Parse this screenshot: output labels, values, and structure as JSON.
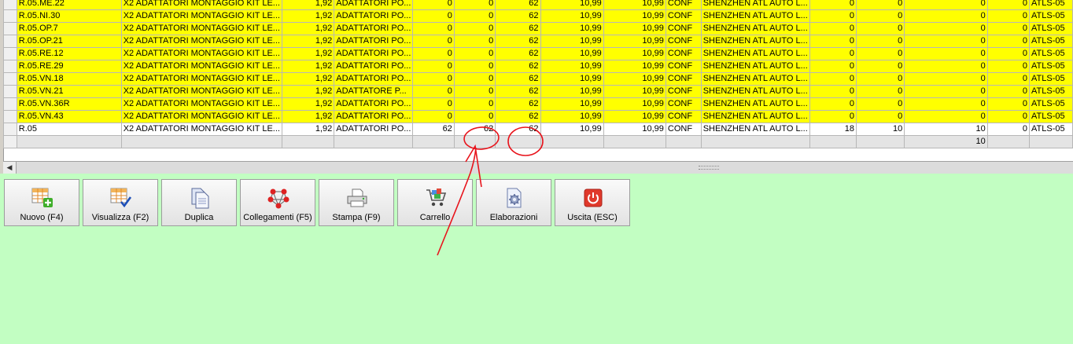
{
  "grid": {
    "rows": [
      {
        "style": "yellow",
        "cells": [
          "R.05.ME.22",
          "X2 ADATTATORI MONTAGGIO KIT LE...",
          "1,92",
          "ADATTATORI PO...",
          "0",
          "0",
          "62",
          "10,99",
          "10,99",
          "CONF",
          "SHENZHEN ATL AUTO L...",
          "0",
          "0",
          "0",
          "0",
          "ATLS-05"
        ]
      },
      {
        "style": "yellow",
        "cells": [
          "R.05.NI.30",
          "X2 ADATTATORI MONTAGGIO KIT LE...",
          "1,92",
          "ADATTATORI PO...",
          "0",
          "0",
          "62",
          "10,99",
          "10,99",
          "CONF",
          "SHENZHEN ATL AUTO L...",
          "0",
          "0",
          "0",
          "0",
          "ATLS-05"
        ]
      },
      {
        "style": "yellow",
        "cells": [
          "R.05.OP.7",
          "X2 ADATTATORI MONTAGGIO KIT LE...",
          "1,92",
          "ADATTATORI PO...",
          "0",
          "0",
          "62",
          "10,99",
          "10,99",
          "CONF",
          "SHENZHEN ATL AUTO L...",
          "0",
          "0",
          "0",
          "0",
          "ATLS-05"
        ]
      },
      {
        "style": "yellow",
        "cells": [
          "R.05.OP.21",
          "X2 ADATTATORI MONTAGGIO KIT LE...",
          "1,92",
          "ADATTATORI PO...",
          "0",
          "0",
          "62",
          "10,99",
          "10,99",
          "CONF",
          "SHENZHEN ATL AUTO L...",
          "0",
          "0",
          "0",
          "0",
          "ATLS-05"
        ]
      },
      {
        "style": "yellow",
        "cells": [
          "R.05.RE.12",
          "X2 ADATTATORI MONTAGGIO KIT LE...",
          "1,92",
          "ADATTATORI PO...",
          "0",
          "0",
          "62",
          "10,99",
          "10,99",
          "CONF",
          "SHENZHEN ATL AUTO L...",
          "0",
          "0",
          "0",
          "0",
          "ATLS-05"
        ]
      },
      {
        "style": "yellow",
        "cells": [
          "R.05.RE.29",
          "X2 ADATTATORI MONTAGGIO KIT LE...",
          "1,92",
          "ADATTATORI PO...",
          "0",
          "0",
          "62",
          "10,99",
          "10,99",
          "CONF",
          "SHENZHEN ATL AUTO L...",
          "0",
          "0",
          "0",
          "0",
          "ATLS-05"
        ]
      },
      {
        "style": "yellow",
        "cells": [
          "R.05.VN.18",
          "X2 ADATTATORI MONTAGGIO KIT LE...",
          "1,92",
          "ADATTATORI PO...",
          "0",
          "0",
          "62",
          "10,99",
          "10,99",
          "CONF",
          "SHENZHEN ATL AUTO L...",
          "0",
          "0",
          "0",
          "0",
          "ATLS-05"
        ]
      },
      {
        "style": "yellow",
        "cells": [
          "R.05.VN.21",
          "X2 ADATTATORI MONTAGGIO KIT LE...",
          "1,92",
          "ADATTATORE P...",
          "0",
          "0",
          "62",
          "10,99",
          "10,99",
          "CONF",
          "SHENZHEN ATL AUTO L...",
          "0",
          "0",
          "0",
          "0",
          "ATLS-05"
        ]
      },
      {
        "style": "yellow",
        "cells": [
          "R.05.VN.36R",
          "X2 ADATTATORI MONTAGGIO KIT LE...",
          "1,92",
          "ADATTATORI PO...",
          "0",
          "0",
          "62",
          "10,99",
          "10,99",
          "CONF",
          "SHENZHEN ATL AUTO L...",
          "0",
          "0",
          "0",
          "0",
          "ATLS-05"
        ]
      },
      {
        "style": "yellow",
        "cells": [
          "R.05.VN.43",
          "X2 ADATTATORI MONTAGGIO KIT LE...",
          "1,92",
          "ADATTATORI PO...",
          "0",
          "0",
          "62",
          "10,99",
          "10,99",
          "CONF",
          "SHENZHEN ATL AUTO L...",
          "0",
          "0",
          "0",
          "0",
          "ATLS-05"
        ]
      },
      {
        "style": "white",
        "cells": [
          "R.05",
          "X2 ADATTATORI MONTAGGIO KIT LE...",
          "1,92",
          "ADATTATORI PO...",
          "62",
          "62",
          "62",
          "10,99",
          "10,99",
          "CONF",
          "SHENZHEN ATL AUTO L...",
          "18",
          "10",
          "10",
          "0",
          "ATLS-05"
        ]
      },
      {
        "style": "total",
        "cells": [
          "",
          "",
          "",
          "",
          "",
          "",
          "",
          "",
          "",
          "",
          "",
          "",
          "",
          "10",
          "",
          ""
        ]
      }
    ],
    "hscroll_left_arrow": "◀"
  },
  "toolbar": {
    "buttons": [
      {
        "name": "nuovo-button",
        "label": "Nuovo (F4)",
        "icon": "grid-add-icon"
      },
      {
        "name": "visualizza-button",
        "label": "Visualizza (F2)",
        "icon": "grid-check-icon"
      },
      {
        "name": "duplica-button",
        "label": "Duplica",
        "icon": "copy-documents-icon"
      },
      {
        "name": "collegamenti-button",
        "label": "Collegamenti (F5)",
        "icon": "links-network-icon"
      },
      {
        "name": "stampa-button",
        "label": "Stampa (F9)",
        "icon": "printer-icon"
      },
      {
        "name": "carrello-button",
        "label": "Carrello",
        "icon": "cart-icon"
      },
      {
        "name": "elaborazioni-button",
        "label": "Elaborazioni",
        "icon": "gear-document-icon"
      },
      {
        "name": "uscita-button",
        "label": "Uscita (ESC)",
        "icon": "power-exit-icon"
      }
    ]
  },
  "colors": {
    "yellow_row": "#ffff00",
    "background": "#c2fec2",
    "annotation": "#e8141c"
  }
}
